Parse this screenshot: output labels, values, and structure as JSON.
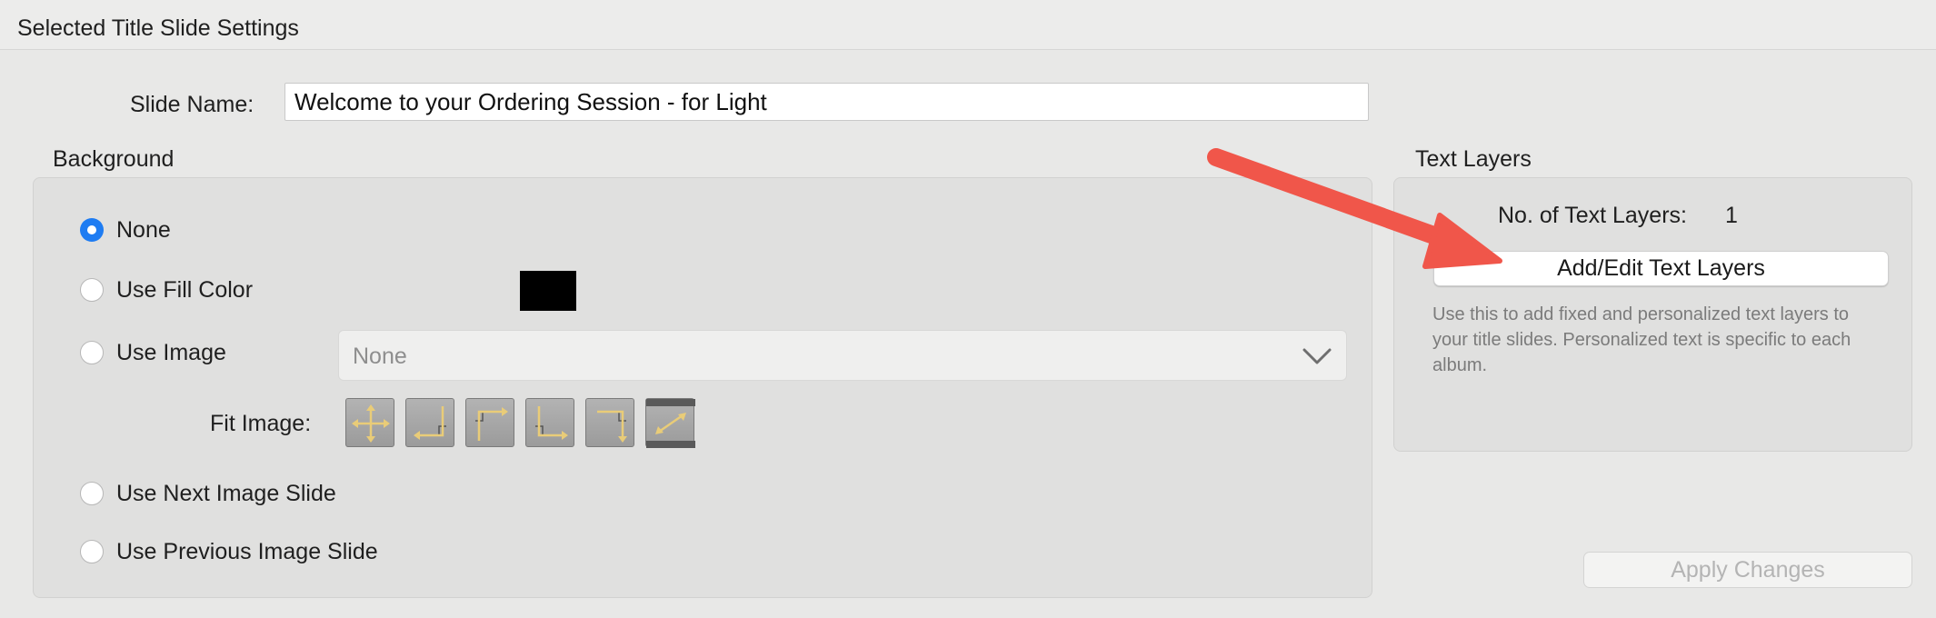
{
  "window": {
    "title": "Selected Title Slide Settings"
  },
  "slide_name": {
    "label": "Slide Name:",
    "value": "Welcome to your Ordering Session - for Light"
  },
  "background": {
    "heading": "Background",
    "options": [
      {
        "label": "None",
        "checked": true
      },
      {
        "label": "Use Fill Color",
        "checked": false
      },
      {
        "label": "Use Image",
        "checked": false
      },
      {
        "label": "Use Next Image Slide",
        "checked": false
      },
      {
        "label": "Use Previous Image Slide",
        "checked": false
      }
    ],
    "fill_color": "#000000",
    "image_select": {
      "value": "None",
      "icon": "chevron-down-icon"
    },
    "fit_image": {
      "label": "Fit Image:",
      "buttons": [
        "fit-center-icon",
        "fit-bottom-right-icon",
        "fit-top-left-icon",
        "fit-bottom-left-icon",
        "fit-top-right-icon",
        "fit-stretch-icon"
      ]
    }
  },
  "text_layers": {
    "heading": "Text Layers",
    "count_label": "No. of Text Layers:",
    "count_value": "1",
    "add_edit_label": "Add/Edit Text Layers",
    "help_text": "Use this to add fixed and personalized text layers to your title slides. Personalized text is specific to each album."
  },
  "apply_label": "Apply Changes",
  "annotation": {
    "arrow_color": "#f0564a"
  }
}
